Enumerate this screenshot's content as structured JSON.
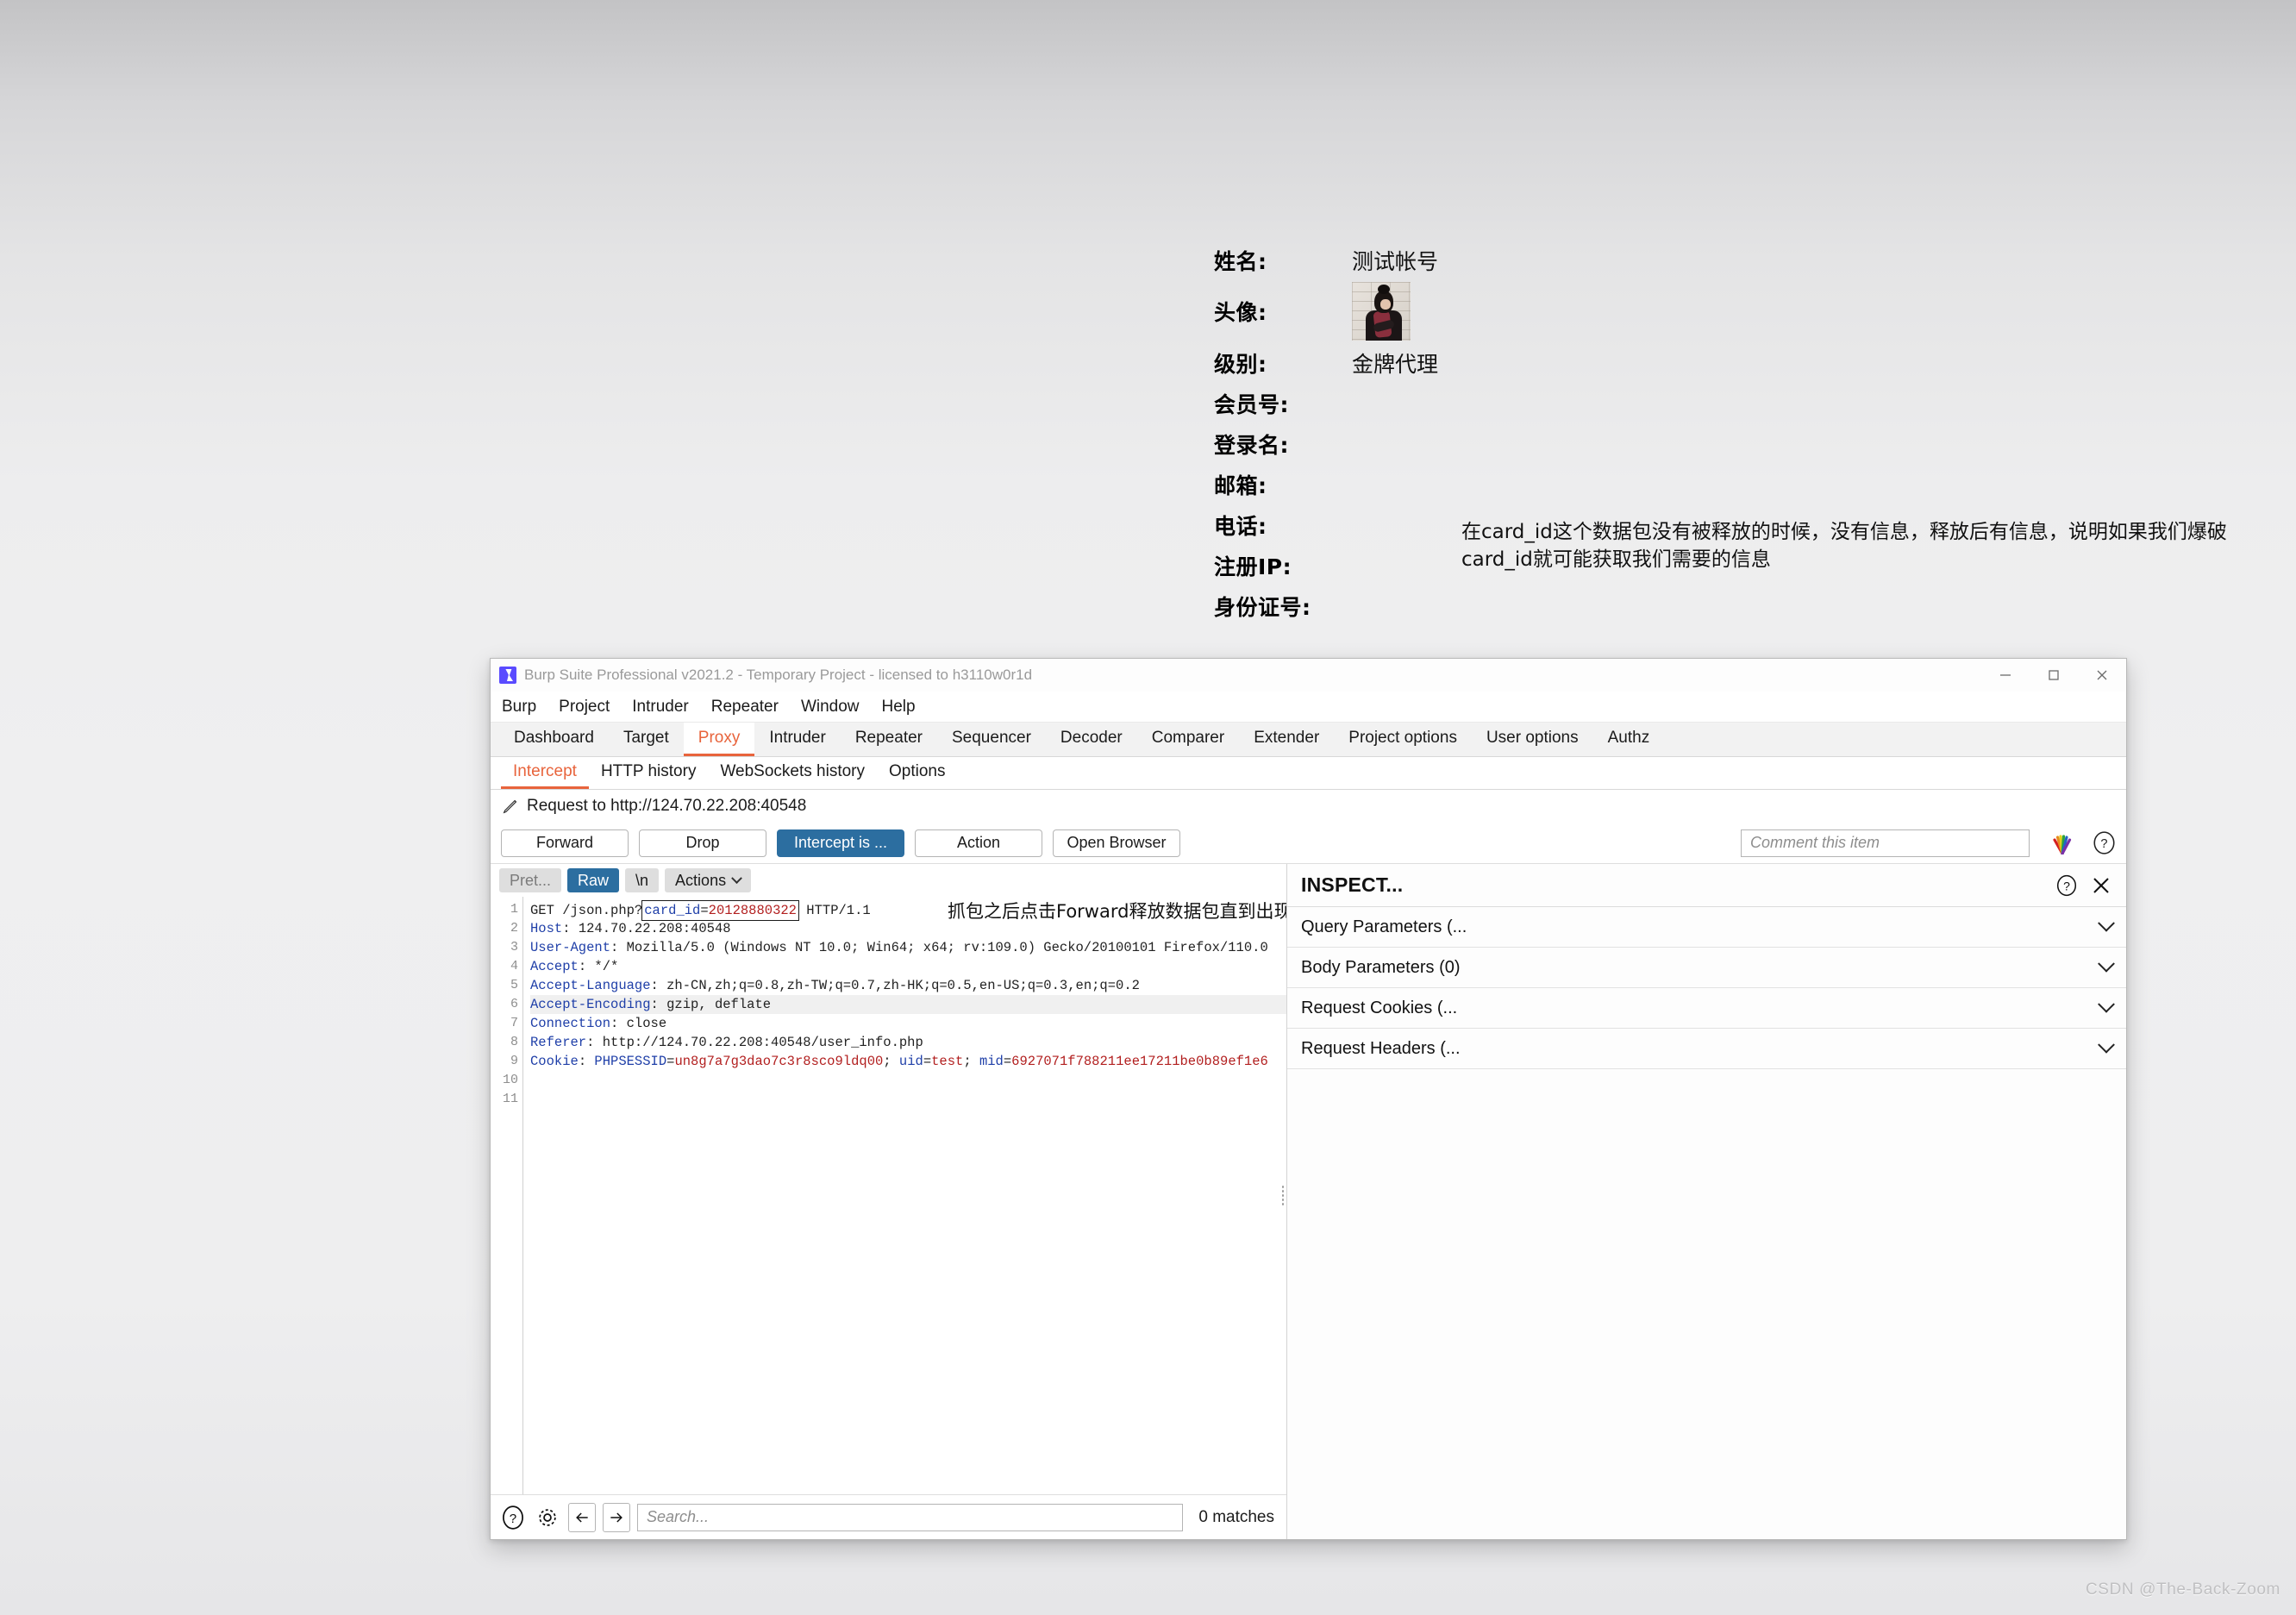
{
  "background_page": {
    "fields": [
      {
        "label": "姓名:",
        "value": "测试帐号",
        "type": "text"
      },
      {
        "label": "头像:",
        "value": "",
        "type": "avatar"
      },
      {
        "label": "级别:",
        "value": "金牌代理",
        "type": "text"
      },
      {
        "label": "会员号:",
        "value": "",
        "type": "text"
      },
      {
        "label": "登录名:",
        "value": "",
        "type": "text"
      },
      {
        "label": "邮箱:",
        "value": "",
        "type": "text"
      },
      {
        "label": "电话:",
        "value": "",
        "type": "text"
      },
      {
        "label": "注册IP:",
        "value": "",
        "type": "text"
      },
      {
        "label": "身份证号:",
        "value": "",
        "type": "text"
      }
    ],
    "annotation": "在card_id这个数据包没有被释放的时候，没有信息，释放后有信息，说明如果我们爆破card_id就可能获取我们需要的信息"
  },
  "burp": {
    "titlebar": {
      "title": "Burp Suite Professional v2021.2 - Temporary Project - licensed to h3110w0r1d",
      "logo_icon": "burp-logo-icon",
      "minimize_icon": "minimize-icon",
      "maximize_icon": "maximize-icon",
      "close_icon": "close-icon"
    },
    "menu": [
      "Burp",
      "Project",
      "Intruder",
      "Repeater",
      "Window",
      "Help"
    ],
    "main_tabs": [
      {
        "label": "Dashboard",
        "active": false
      },
      {
        "label": "Target",
        "active": false
      },
      {
        "label": "Proxy",
        "active": true
      },
      {
        "label": "Intruder",
        "active": false
      },
      {
        "label": "Repeater",
        "active": false
      },
      {
        "label": "Sequencer",
        "active": false
      },
      {
        "label": "Decoder",
        "active": false
      },
      {
        "label": "Comparer",
        "active": false
      },
      {
        "label": "Extender",
        "active": false
      },
      {
        "label": "Project options",
        "active": false
      },
      {
        "label": "User options",
        "active": false
      },
      {
        "label": "Authz",
        "active": false
      }
    ],
    "sub_tabs": [
      {
        "label": "Intercept",
        "active": true
      },
      {
        "label": "HTTP history",
        "active": false
      },
      {
        "label": "WebSockets history",
        "active": false
      },
      {
        "label": "Options",
        "active": false
      }
    ],
    "request_to": {
      "icon": "pencil-icon",
      "text": "Request to http://124.70.22.208:40548"
    },
    "action_buttons": [
      {
        "label": "Forward",
        "primary": false
      },
      {
        "label": "Drop",
        "primary": false
      },
      {
        "label": "Intercept is ...",
        "primary": true
      },
      {
        "label": "Action",
        "primary": false
      },
      {
        "label": "Open Browser",
        "primary": false
      }
    ],
    "comment_placeholder": "Comment this item",
    "fan_icon": "rainbow-fan-icon",
    "help_icon": "help-circle-icon",
    "editor_toolbar": [
      {
        "label": "Pret...",
        "state": "inactive"
      },
      {
        "label": "Raw",
        "state": "active"
      },
      {
        "label": "\\n",
        "state": "plain"
      },
      {
        "label": "Actions",
        "state": "plain",
        "caret": true
      }
    ],
    "code_annotation": "抓包之后点击Forward释放数据包直到出现Card_id",
    "request_lines": [
      {
        "n": "1",
        "parts": [
          {
            "t": "GET /json.php?",
            "c": "d"
          },
          {
            "t": "card_id",
            "c": "k",
            "boxed": true
          },
          {
            "t": "=",
            "c": "d",
            "boxed": true
          },
          {
            "t": "20128880322",
            "c": "r",
            "boxed": true
          },
          {
            "t": " HTTP/1.1",
            "c": "d"
          }
        ]
      },
      {
        "n": "2",
        "parts": [
          {
            "t": "Host",
            "c": "k"
          },
          {
            "t": ": 124.70.22.208:40548",
            "c": "d"
          }
        ]
      },
      {
        "n": "3",
        "parts": [
          {
            "t": "User-Agent",
            "c": "k"
          },
          {
            "t": ": Mozilla/5.0 (Windows NT 10.0; Win64; x64; rv:109.0) Gecko/20100101 Firefox/110.0",
            "c": "d"
          }
        ]
      },
      {
        "n": "4",
        "parts": [
          {
            "t": "Accept",
            "c": "k"
          },
          {
            "t": ": */*",
            "c": "d"
          }
        ]
      },
      {
        "n": "5",
        "parts": [
          {
            "t": "Accept-Language",
            "c": "k"
          },
          {
            "t": ": zh-CN,zh;q=0.8,zh-TW;q=0.7,zh-HK;q=0.5,en-US;q=0.3,en;q=0.2",
            "c": "d"
          }
        ]
      },
      {
        "n": "6",
        "highlight": true,
        "parts": [
          {
            "t": "Accept-Encoding",
            "c": "k"
          },
          {
            "t": ": gzip, deflate",
            "c": "d"
          }
        ]
      },
      {
        "n": "7",
        "parts": [
          {
            "t": "Connection",
            "c": "k"
          },
          {
            "t": ": close",
            "c": "d"
          }
        ]
      },
      {
        "n": "8",
        "parts": [
          {
            "t": "Referer",
            "c": "k"
          },
          {
            "t": ": http://124.70.22.208:40548/user_info.php",
            "c": "d"
          }
        ]
      },
      {
        "n": "9",
        "parts": [
          {
            "t": "Cookie",
            "c": "k"
          },
          {
            "t": ": ",
            "c": "d"
          },
          {
            "t": "PHPSESSID",
            "c": "k"
          },
          {
            "t": "=",
            "c": "d"
          },
          {
            "t": "un8g7a7g3dao7c3r8sco9ldq00",
            "c": "r"
          },
          {
            "t": "; ",
            "c": "d"
          },
          {
            "t": "uid",
            "c": "k"
          },
          {
            "t": "=",
            "c": "d"
          },
          {
            "t": "test",
            "c": "r"
          },
          {
            "t": "; ",
            "c": "d"
          },
          {
            "t": "mid",
            "c": "k"
          },
          {
            "t": "=",
            "c": "d"
          },
          {
            "t": "6927071f788211ee17211be0b89ef1e6",
            "c": "r"
          }
        ]
      },
      {
        "n": "10",
        "parts": []
      },
      {
        "n": "11",
        "parts": []
      }
    ],
    "search": {
      "help_icon": "help-circle-icon",
      "settings_icon": "gear-icon",
      "prev_icon": "arrow-left-icon",
      "next_icon": "arrow-right-icon",
      "placeholder": "Search...",
      "value": "",
      "matches": "0 matches"
    },
    "inspector": {
      "title": "INSPECT...",
      "help_icon": "help-circle-icon",
      "close_icon": "close-icon",
      "sections": [
        {
          "label": "Query Parameters (...",
          "chevron": "chevron-down-icon"
        },
        {
          "label": "Body Parameters (0)",
          "chevron": "chevron-down-icon"
        },
        {
          "label": "Request Cookies (...",
          "chevron": "chevron-down-icon"
        },
        {
          "label": "Request Headers (...",
          "chevron": "chevron-down-icon"
        }
      ]
    }
  },
  "watermark": "CSDN @The-Back-Zoom",
  "colors": {
    "accent_orange": "#e8643c",
    "primary_blue": "#2c6ea0",
    "burp_logo": "#5a4bff",
    "code_key": "#1f3fa8",
    "code_value": "#b21f1f"
  }
}
